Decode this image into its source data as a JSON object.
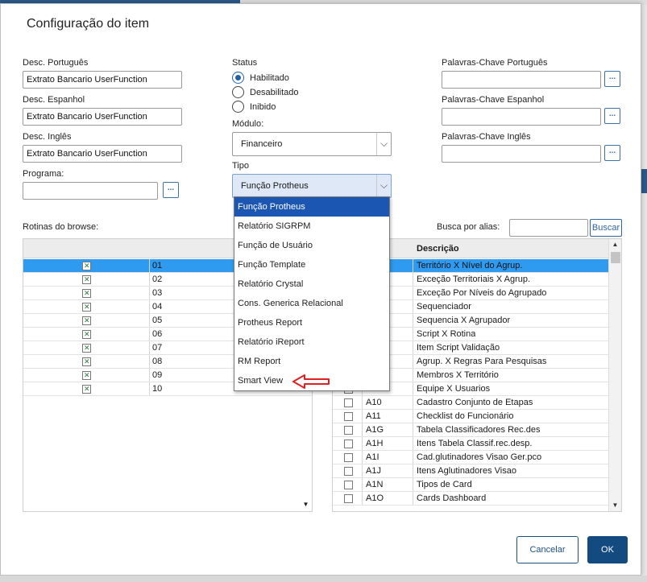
{
  "dialog": {
    "title": "Configuração do item"
  },
  "fields": {
    "desc_pt_label": "Desc. Português",
    "desc_pt_value": "Extrato Bancario UserFunction",
    "desc_es_label": "Desc. Espanhol",
    "desc_es_value": "Extrato Bancario UserFunction",
    "desc_en_label": "Desc. Inglês",
    "desc_en_value": "Extrato Bancario UserFunction",
    "programa_label": "Programa:",
    "programa_value": "",
    "ellipsis": "...",
    "status_label": "Status",
    "status_options": [
      "Habilitado",
      "Desabilitado",
      "Inibido"
    ],
    "modulo_label": "Módulo:",
    "modulo_value": "Financeiro",
    "tipo_label": "Tipo",
    "tipo_value": "Função Protheus",
    "kw_pt_label": "Palavras-Chave Português",
    "kw_es_label": "Palavras-Chave Espanhol",
    "kw_en_label": "Palavras-Chave Inglês"
  },
  "tipo_dropdown": {
    "items": [
      "Função Protheus",
      "Relatório SIGRPM",
      "Função de Usuário",
      "Função Template",
      "Relatório Crystal",
      "Cons. Generica Relacional",
      "Protheus Report",
      "Relatório iReport",
      "RM Report",
      "Smart View"
    ],
    "annotation_color": "#e02020"
  },
  "left_grid": {
    "label": "Rotinas do browse:",
    "rows": [
      "01",
      "02",
      "03",
      "04",
      "05",
      "06",
      "07",
      "08",
      "09",
      "10"
    ]
  },
  "right_grid": {
    "search_label": "Busca por alias:",
    "search_value": "",
    "search_button": "Buscar",
    "header_desc": "Descrição",
    "rows": [
      {
        "alias": "",
        "desc": "Território X Nível do Agrup."
      },
      {
        "alias": "",
        "desc": "Exceção Territoriais X Agrup."
      },
      {
        "alias": "",
        "desc": "Exceção Por Níveis do Agrupado"
      },
      {
        "alias": "",
        "desc": "Sequenciador"
      },
      {
        "alias": "",
        "desc": "Sequencia X Agrupador"
      },
      {
        "alias": "",
        "desc": "Script X Rotina"
      },
      {
        "alias": "",
        "desc": "Item Script Validação"
      },
      {
        "alias": "",
        "desc": "Agrup. X Regras Para Pesquisas"
      },
      {
        "alias": "",
        "desc": "Membros X Território"
      },
      {
        "alias": "",
        "desc": "Equipe X Usuarios"
      },
      {
        "alias": "A10",
        "desc": "Cadastro Conjunto de Etapas"
      },
      {
        "alias": "A11",
        "desc": "Checklist do Funcionário"
      },
      {
        "alias": "A1G",
        "desc": "Tabela Classificadores Rec.des"
      },
      {
        "alias": "A1H",
        "desc": "Itens Tabela Classif.rec.desp."
      },
      {
        "alias": "A1I",
        "desc": "Cad.glutinadores Visao Ger.pco"
      },
      {
        "alias": "A1J",
        "desc": "Itens Aglutinadores Visao"
      },
      {
        "alias": "A1N",
        "desc": "Tipos de Card"
      },
      {
        "alias": "A1O",
        "desc": "Cards Dashboard"
      }
    ]
  },
  "buttons": {
    "cancel": "Cancelar",
    "ok": "OK"
  },
  "colors": {
    "selection": "#2e9bf0",
    "primary": "#134a80",
    "dropdown_active": "#1c56b3"
  }
}
